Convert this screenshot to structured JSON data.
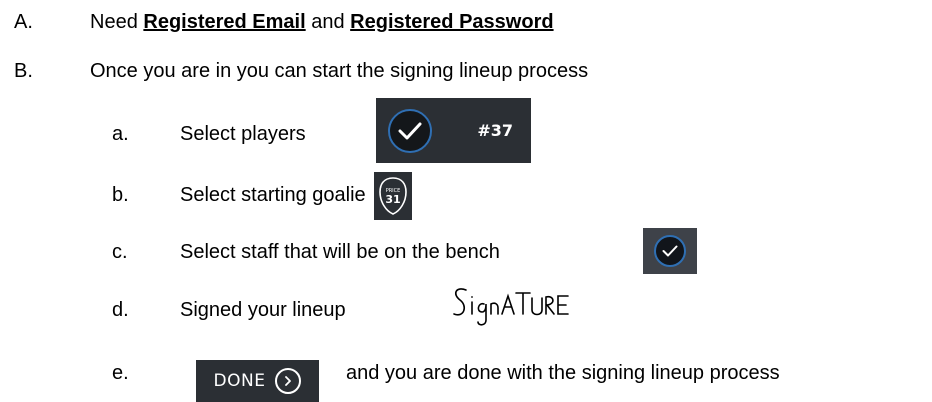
{
  "items": {
    "A": {
      "marker": "A.",
      "prefix": "Need ",
      "email": "Registered Email",
      "middle": " and ",
      "password": "Registered Password"
    },
    "B": {
      "marker": "B.",
      "text": "Once you are in you can start the signing lineup process"
    },
    "sub": {
      "a": {
        "marker": "a.",
        "text": "Select players"
      },
      "b": {
        "marker": "b.",
        "text": "Select starting goalie"
      },
      "c": {
        "marker": "c.",
        "text": "Select staff that will be on the bench"
      },
      "d": {
        "marker": "d.",
        "text": "Signed your lineup"
      },
      "e": {
        "marker": "e.",
        "text": "and you are done with the signing lineup process"
      }
    }
  },
  "players_chip": {
    "number": "#37",
    "icon": "check-circle-icon"
  },
  "goalie_chip": {
    "top_text": "PRICE",
    "number": "31",
    "icon": "goalie-mask-icon"
  },
  "staff_chip": {
    "icon": "check-circle-icon"
  },
  "signature": {
    "icon": "handwritten-signature",
    "text": "SignATURE"
  },
  "done_button": {
    "label": "DONE",
    "icon": "chevron-right-circle-icon"
  },
  "colors": {
    "chip_dark": "#2b2f34",
    "staff_chip": "#3e4249",
    "accent_blue": "#2f6fb3",
    "white": "#ffffff"
  }
}
